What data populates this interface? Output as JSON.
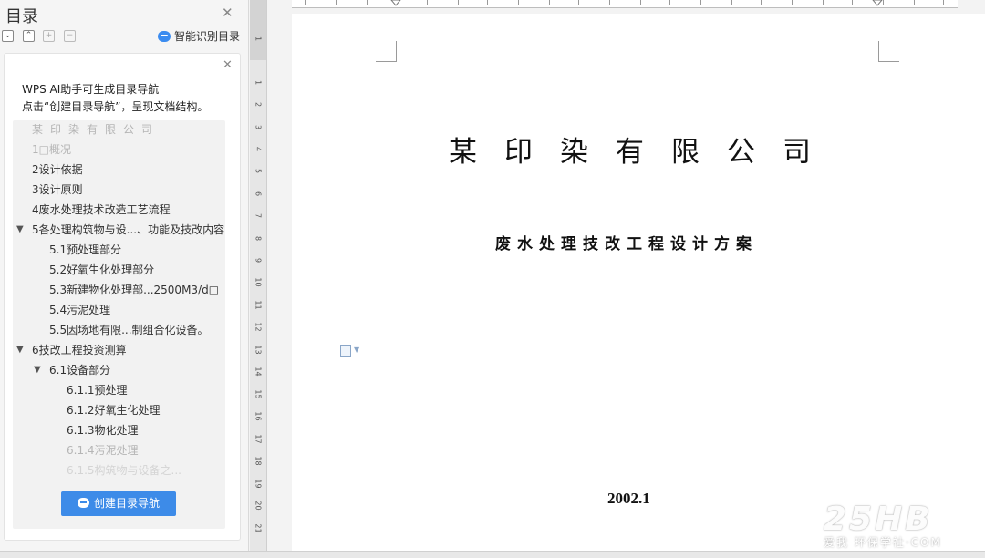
{
  "sidebar": {
    "title": "目录",
    "smart_toc_label": "智能识别目录",
    "tool_icons": [
      "collapse-icon",
      "expand-icon",
      "promote-icon",
      "demote-icon"
    ],
    "tip_line1": "WPS AI助手可生成目录导航",
    "tip_line2": "点击“创建目录导航”，呈现文档结构。",
    "toc": [
      {
        "label": "某印染有限公司",
        "level": 0,
        "state": "dim"
      },
      {
        "label": "1□概况",
        "level": 1,
        "state": "dim"
      },
      {
        "label": "2设计依据",
        "level": 1,
        "state": "normal"
      },
      {
        "label": "3设计原则",
        "level": 1,
        "state": "normal"
      },
      {
        "label": "4废水处理技术改造工艺流程",
        "level": 1,
        "state": "normal"
      },
      {
        "label": "5各处理构筑物与设...、功能及技改内容",
        "level": 1,
        "state": "normal",
        "expanded": true
      },
      {
        "label": "5.1预处理部分",
        "level": 2,
        "state": "normal"
      },
      {
        "label": "5.2好氧生化处理部分",
        "level": 2,
        "state": "normal"
      },
      {
        "label": "5.3新建物化处理部...2500M3/d□",
        "level": 2,
        "state": "normal"
      },
      {
        "label": "5.4污泥处理",
        "level": 2,
        "state": "normal"
      },
      {
        "label": "5.5因场地有限...制组合化设备。",
        "level": 2,
        "state": "normal"
      },
      {
        "label": "6技改工程投资测算",
        "level": 1,
        "state": "normal",
        "expanded": true
      },
      {
        "label": "6.1设备部分",
        "level": 2,
        "state": "normal",
        "expanded": true
      },
      {
        "label": "6.1.1预处理",
        "level": 3,
        "state": "normal"
      },
      {
        "label": "6.1.2好氧生化处理",
        "level": 3,
        "state": "normal"
      },
      {
        "label": "6.1.3物化处理",
        "level": 3,
        "state": "normal"
      },
      {
        "label": "6.1.4污泥处理",
        "level": 3,
        "state": "dim"
      },
      {
        "label": "6.1.5构筑物与设备之...",
        "level": 3,
        "state": "faint"
      }
    ],
    "create_button": "创建目录导航"
  },
  "ruler": {
    "vertical": [
      "1",
      "1",
      "2",
      "3",
      "4",
      "5",
      "6",
      "7",
      "8",
      "9",
      "10",
      "11",
      "12",
      "13",
      "14",
      "15",
      "16",
      "17",
      "18",
      "19",
      "20",
      "21"
    ]
  },
  "document": {
    "title": "某印染有限公司",
    "subtitle": "废水处理技改工程设计方案",
    "date": "2002.1"
  },
  "watermark": {
    "big": "25HB",
    "small": "爱我 环保学社·COM"
  }
}
